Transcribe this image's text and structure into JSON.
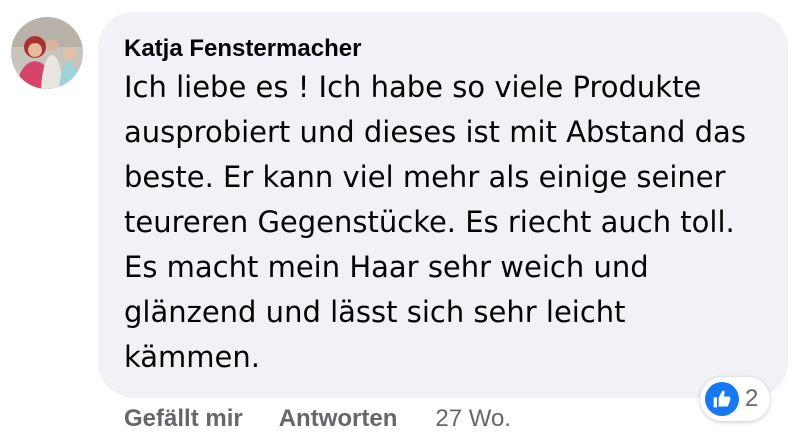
{
  "comment": {
    "author_name": "Katja Fenstermacher",
    "text": "Ich liebe es ! Ich habe so viele Produkte\nausprobiert und dieses ist mit Abstand das\nbeste. Er kann viel mehr als einige seiner\nteureren Gegenstücke. Es riecht auch toll.\nEs macht mein Haar sehr weich und\nglänzend und lässt sich sehr leicht\nkämmen."
  },
  "reactions": {
    "icon": "thumbs-up-icon",
    "count": "2",
    "color": "#1877f2"
  },
  "actions": {
    "like_label": "Gefällt mir",
    "reply_label": "Antworten",
    "timestamp": "27 Wo."
  },
  "colors": {
    "bubble_background": "#f0f2f5",
    "secondary_text": "#65676b",
    "primary_text": "#050505"
  }
}
